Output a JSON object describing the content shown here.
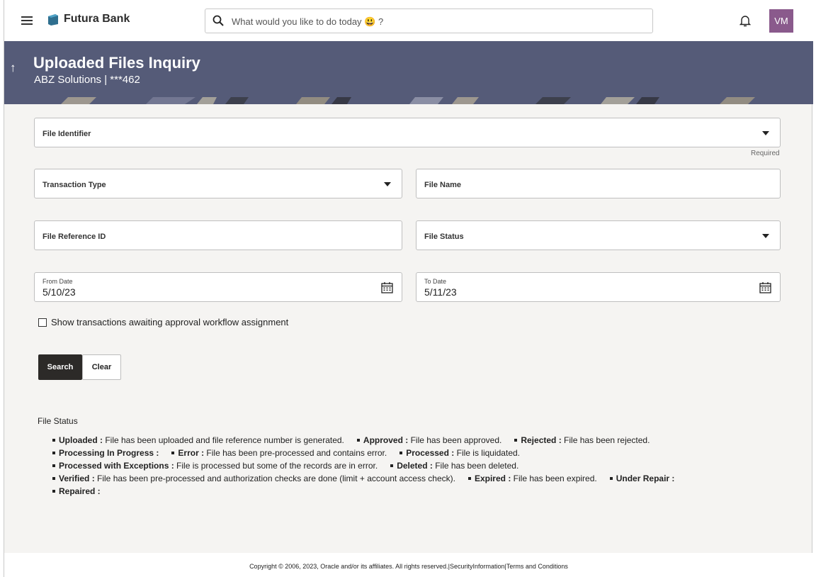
{
  "app": {
    "brand": "Futura Bank",
    "avatar_initials": "VM",
    "search_placeholder": "What would you like to do today 😃 ?"
  },
  "header": {
    "title": "Uploaded Files Inquiry",
    "subtitle": "ABZ Solutions | ***462"
  },
  "form": {
    "file_identifier": {
      "label": "File Identifier",
      "required_note": "Required"
    },
    "transaction_type": {
      "label": "Transaction Type"
    },
    "file_name": {
      "label": "File Name"
    },
    "file_reference_id": {
      "label": "File Reference ID"
    },
    "file_status": {
      "label": "File Status"
    },
    "from_date": {
      "label": "From Date",
      "value": "5/10/23"
    },
    "to_date": {
      "label": "To Date",
      "value": "5/11/23"
    },
    "approval_checkbox": {
      "label": "Show transactions awaiting approval workflow assignment",
      "checked": false
    },
    "search_button": "Search",
    "clear_button": "Clear"
  },
  "legend": {
    "title": "File Status",
    "lines": [
      [
        {
          "term": "Uploaded :",
          "desc": " File has been uploaded and file reference number is generated."
        },
        {
          "term": "Approved :",
          "desc": " File has been approved."
        },
        {
          "term": "Rejected :",
          "desc": " File has been rejected."
        }
      ],
      [
        {
          "term": "Processing In Progress :",
          "desc": ""
        },
        {
          "term": "Error :",
          "desc": " File has been pre-processed and contains error."
        },
        {
          "term": "Processed :",
          "desc": " File is liquidated."
        }
      ],
      [
        {
          "term": "Processed with Exceptions :",
          "desc": " File is processed but some of the records are in error."
        },
        {
          "term": "Deleted :",
          "desc": " File has been deleted."
        }
      ],
      [
        {
          "term": "Verified :",
          "desc": " File has been pre-processed and authorization checks are done (limit + account access check)."
        },
        {
          "term": "Expired :",
          "desc": " File has been expired."
        },
        {
          "term": "Under Repair :",
          "desc": ""
        }
      ],
      [
        {
          "term": "Repaired :",
          "desc": ""
        }
      ]
    ]
  },
  "footer": {
    "copyright": "Copyright © 2006, 2023, Oracle and/or its affiliates. All rights reserved.|SecurityInformation|Terms and Conditions"
  },
  "colors": {
    "banner": "#555b78",
    "avatar": "#8a5a8c",
    "primary_button": "#2c2a28",
    "background": "#f5f4f2"
  }
}
